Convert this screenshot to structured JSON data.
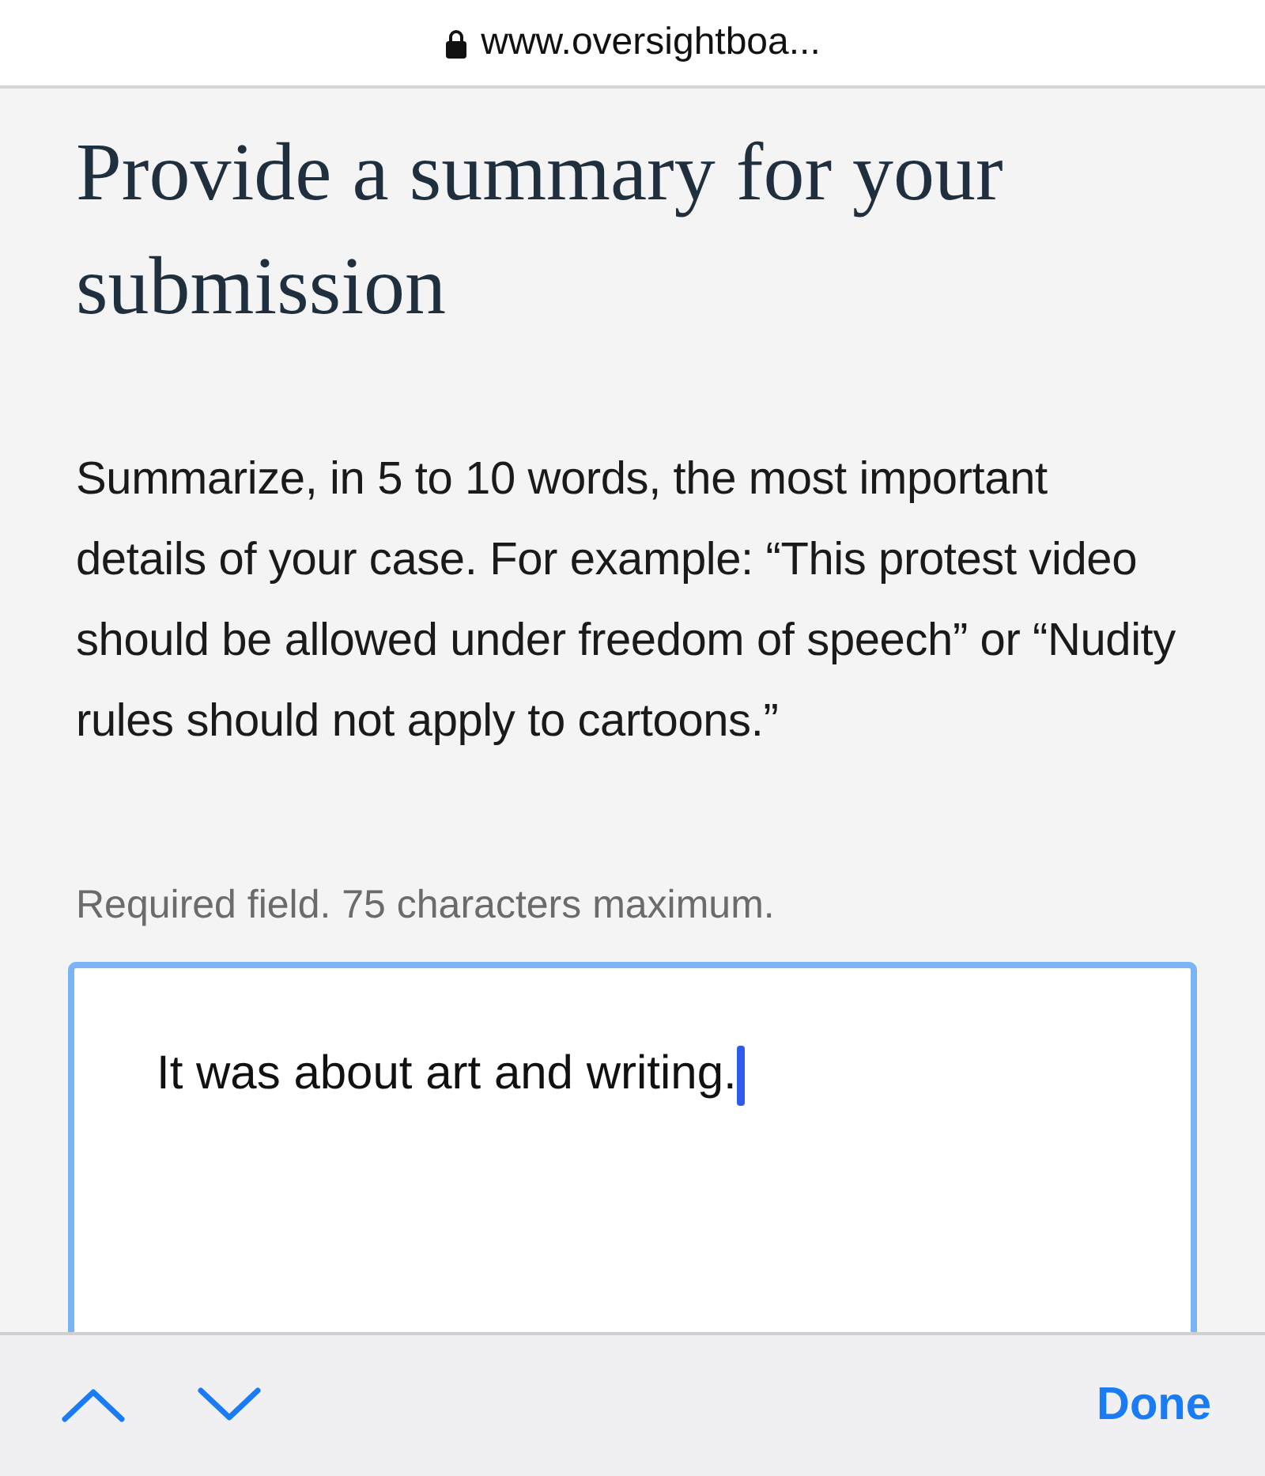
{
  "address_bar": {
    "url": "www.oversightboa...",
    "secure": true
  },
  "heading": "Provide a summary for your submission",
  "description": "Summarize, in 5 to 10 words, the most important details of your case. For example: “This protest video should be allowed under freedom of speech” or “Nudity rules should not apply to cartoons.”",
  "field": {
    "hint": "Required field. 75 characters maximum.",
    "value": "It was about art and writing.",
    "focused": true
  },
  "keyboard_toolbar": {
    "done": "Done"
  }
}
